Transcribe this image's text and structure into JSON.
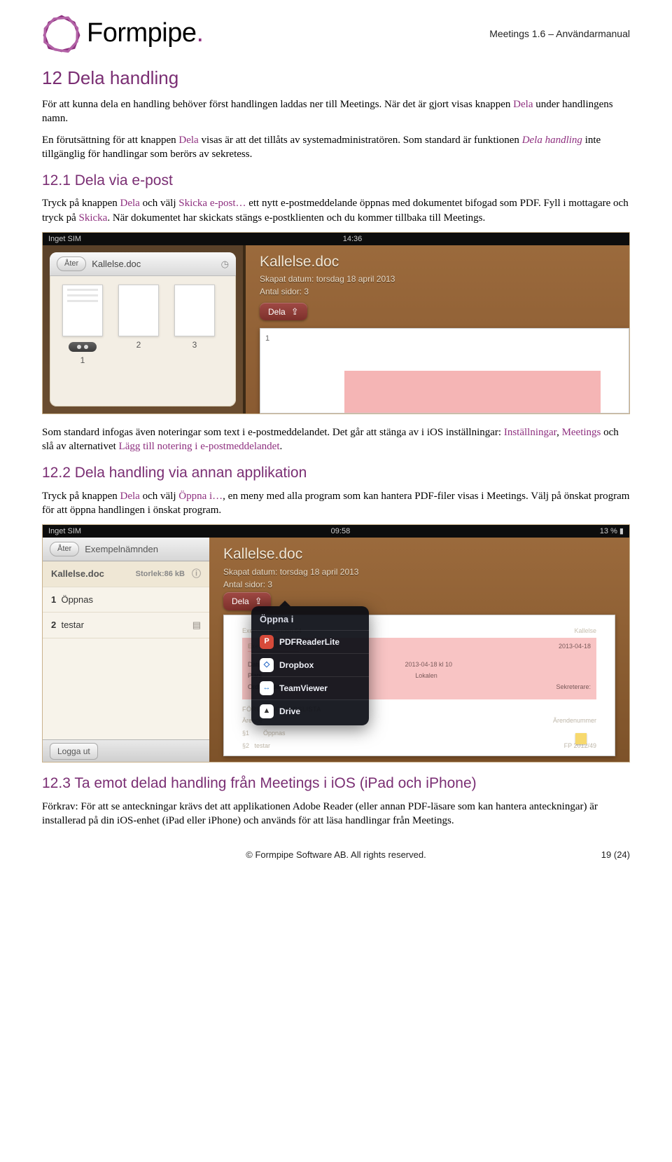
{
  "header": {
    "brand_name": "Formpipe",
    "brand_dot": ".",
    "doc_meta": "Meetings 1.6 – Användarmanual"
  },
  "section12": {
    "title": "12 Dela handling",
    "p1_a": "För att kunna dela en handling behöver först handlingen laddas ner till Meetings. När det är gjort visas knappen ",
    "p1_dela": "Dela",
    "p1_b": " under handlingens namn.",
    "p2_a": "En förutsättning för att knappen ",
    "p2_dela": "Dela",
    "p2_b": " visas är att det tillåts av systemadministratören. Som standard är funktionen ",
    "p2_italic": "Dela handling",
    "p2_c": " inte tillgänglig för handlingar som berörs av sekretess."
  },
  "section12_1": {
    "title": "12.1 Dela via e-post",
    "p1_a": "Tryck på knappen ",
    "p1_dela": "Dela",
    "p1_b": " och välj ",
    "p1_skicka": "Skicka e-post…",
    "p1_c": " ett nytt e-postmeddelande öppnas med dokumentet bifogad som PDF. Fyll i mottagare och tryck på ",
    "p1_skicka2": "Skicka",
    "p1_d": ". När dokumentet har skickats stängs e-postklienten och du kommer tillbaka till Meetings.",
    "p2_a": "Som standard infogas även noteringar som text i e-postmeddelandet. Det går att stänga av i iOS inställningar: ",
    "p2_inst": "Inställningar",
    "p2_b": ", ",
    "p2_meetings": "Meetings",
    "p2_c": " och slå av alternativet ",
    "p2_opt": "Lägg till notering i e-postmeddelandet",
    "p2_d": "."
  },
  "section12_2": {
    "title": "12.2 Dela handling via annan applikation",
    "p1_a": "Tryck på knappen ",
    "p1_dela": "Dela",
    "p1_b": " och välj ",
    "p1_open": "Öppna i…",
    "p1_c": ", en meny med alla program som kan hantera PDF-filer visas i Meetings. Välj på önskat program för att öppna handlingen i önskat program."
  },
  "section12_3": {
    "title": "12.3 Ta emot delad handling från Meetings i iOS (iPad och iPhone)",
    "p1": "Förkrav: För att se anteckningar krävs det att applikationen Adobe Reader (eller annan PDF-läsare som kan hantera anteckningar) är installerad på din iOS-enhet (iPad eller iPhone) och används för att läsa handlingar från Meetings."
  },
  "ss1": {
    "status_left": "Inget SIM",
    "status_time": "14:36",
    "back": "Åter",
    "doc_title": "Kallelse.doc",
    "thumbs": [
      "1",
      "2",
      "3"
    ],
    "meta_title": "Kallelse.doc",
    "meta_date": "Skapat datum: torsdag 18 april 2013",
    "meta_pages": "Antal sidor: 3",
    "dela": "Dela",
    "page_no": "1"
  },
  "ss2": {
    "status_left": "Inget SIM",
    "status_time": "09:58",
    "status_right": "13 %",
    "back": "Åter",
    "crumb": "Exempelnämnden",
    "doc_title": "Kallelse.doc",
    "size": "Storlek:86 kB",
    "rows": [
      {
        "n": "1",
        "t": "Öppnas"
      },
      {
        "n": "2",
        "t": "testar"
      }
    ],
    "logout": "Logga ut",
    "meta_title": "Kallelse.doc",
    "meta_date": "Skapat datum: torsdag 18 april 2013",
    "meta_pages": "Antal sidor: 3",
    "dela": "Dela",
    "popover_title": "Öppna i ",
    "apps": [
      "PDFReaderLite",
      "Dropbox",
      "TeamViewer",
      "Drive"
    ],
    "agenda": {
      "org": "Exempelnämnden 64",
      "kall": "Kallelse",
      "hdr": "Exempelnämnden",
      "date": "2013-04-18",
      "rows": [
        {
          "k": "Datum",
          "v": "2013-04-18 kl 10",
          "r": ""
        },
        {
          "k": "Plats",
          "v": "Lokalen",
          "r": ""
        },
        {
          "k": "Ordförande",
          "v": "",
          "r": "Sekreterare:"
        }
      ],
      "listhdr": "FÖREDRAGNINGSLISTA",
      "cols": {
        "a": "Ärende",
        "b": "Ärendenummer"
      },
      "items": [
        {
          "n": "§1",
          "t": "Öppnas",
          "r": ""
        },
        {
          "n": "§2",
          "t": "testar",
          "r": "FP 2012/49"
        }
      ]
    }
  },
  "footer": {
    "copyright": "© Formpipe Software AB. All rights reserved.",
    "page": "19 (24)"
  }
}
